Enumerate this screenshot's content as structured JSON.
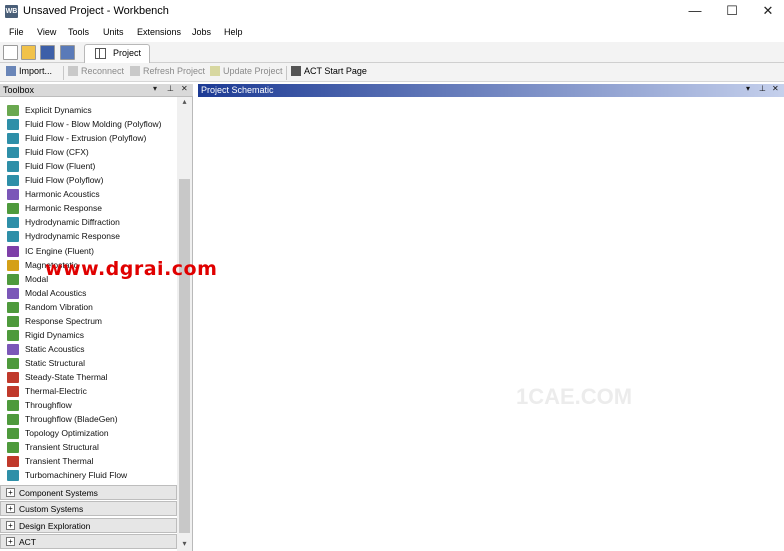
{
  "window": {
    "title": "Unsaved Project - Workbench",
    "app_icon_text": "WB",
    "controls": [
      "—",
      "☐",
      "✕"
    ]
  },
  "menu": [
    {
      "label": "File"
    },
    {
      "label": "View"
    },
    {
      "label": "Tools"
    },
    {
      "label": "Units"
    },
    {
      "label": "Extensions"
    },
    {
      "label": "Jobs"
    },
    {
      "label": "Help"
    }
  ],
  "tabs": {
    "project": "Project"
  },
  "toolbar": {
    "import": "Import...",
    "reconnect": "Reconnect",
    "refresh": "Refresh Project",
    "update": "Update Project",
    "act": "ACT Start Page"
  },
  "toolbox": {
    "title": "Toolbox",
    "items": [
      {
        "label": "Explicit Dynamics",
        "icon": "explicit-icon",
        "color": "#6aa84f"
      },
      {
        "label": "Fluid Flow - Blow Molding (Polyflow)",
        "icon": "fluid-icon",
        "color": "#2e8fa8"
      },
      {
        "label": "Fluid Flow - Extrusion (Polyflow)",
        "icon": "fluid-icon",
        "color": "#2e8fa8"
      },
      {
        "label": "Fluid Flow (CFX)",
        "icon": "fluid-icon",
        "color": "#2e8fa8"
      },
      {
        "label": "Fluid Flow (Fluent)",
        "icon": "fluid-icon",
        "color": "#2e8fa8"
      },
      {
        "label": "Fluid Flow (Polyflow)",
        "icon": "fluid-icon",
        "color": "#2e8fa8"
      },
      {
        "label": "Harmonic Acoustics",
        "icon": "acoustics-icon",
        "color": "#7b57b8"
      },
      {
        "label": "Harmonic Response",
        "icon": "harmonic-icon",
        "color": "#4e9a3c"
      },
      {
        "label": "Hydrodynamic Diffraction",
        "icon": "hydro-icon",
        "color": "#2e8fa8"
      },
      {
        "label": "Hydrodynamic Response",
        "icon": "hydro-icon",
        "color": "#2e8fa8"
      },
      {
        "label": "IC Engine (Fluent)",
        "icon": "engine-icon",
        "color": "#7e3fa8"
      },
      {
        "label": "Magnetostatic",
        "icon": "magnet-icon",
        "color": "#d4a017"
      },
      {
        "label": "Modal",
        "icon": "modal-icon",
        "color": "#4e9a3c"
      },
      {
        "label": "Modal Acoustics",
        "icon": "acoustics-icon",
        "color": "#7b57b8"
      },
      {
        "label": "Random Vibration",
        "icon": "vibration-icon",
        "color": "#4e9a3c"
      },
      {
        "label": "Response Spectrum",
        "icon": "spectrum-icon",
        "color": "#4e9a3c"
      },
      {
        "label": "Rigid Dynamics",
        "icon": "rigid-icon",
        "color": "#4e9a3c"
      },
      {
        "label": "Static Acoustics",
        "icon": "acoustics-icon",
        "color": "#7b57b8"
      },
      {
        "label": "Static Structural",
        "icon": "structural-icon",
        "color": "#4e9a3c"
      },
      {
        "label": "Steady-State Thermal",
        "icon": "thermal-icon",
        "color": "#c0392b"
      },
      {
        "label": "Thermal-Electric",
        "icon": "thermal-electric-icon",
        "color": "#c0392b"
      },
      {
        "label": "Throughflow",
        "icon": "throughflow-icon",
        "color": "#4e9a3c"
      },
      {
        "label": "Throughflow (BladeGen)",
        "icon": "throughflow-icon",
        "color": "#4e9a3c"
      },
      {
        "label": "Topology Optimization",
        "icon": "topology-icon",
        "color": "#4e9a3c"
      },
      {
        "label": "Transient Structural",
        "icon": "structural-icon",
        "color": "#4e9a3c"
      },
      {
        "label": "Transient Thermal",
        "icon": "thermal-icon",
        "color": "#c0392b"
      },
      {
        "label": "Turbomachinery Fluid Flow",
        "icon": "turbo-icon",
        "color": "#2e8fa8"
      }
    ],
    "sections": [
      {
        "label": "Component Systems",
        "expander": "+"
      },
      {
        "label": "Custom Systems",
        "expander": "+"
      },
      {
        "label": "Design Exploration",
        "expander": "+"
      },
      {
        "label": "ACT",
        "expander": "+"
      }
    ]
  },
  "schematic": {
    "title": "Project Schematic"
  },
  "watermarks": {
    "site": "www.dgrai.com",
    "cae": "1CAE.COM"
  }
}
